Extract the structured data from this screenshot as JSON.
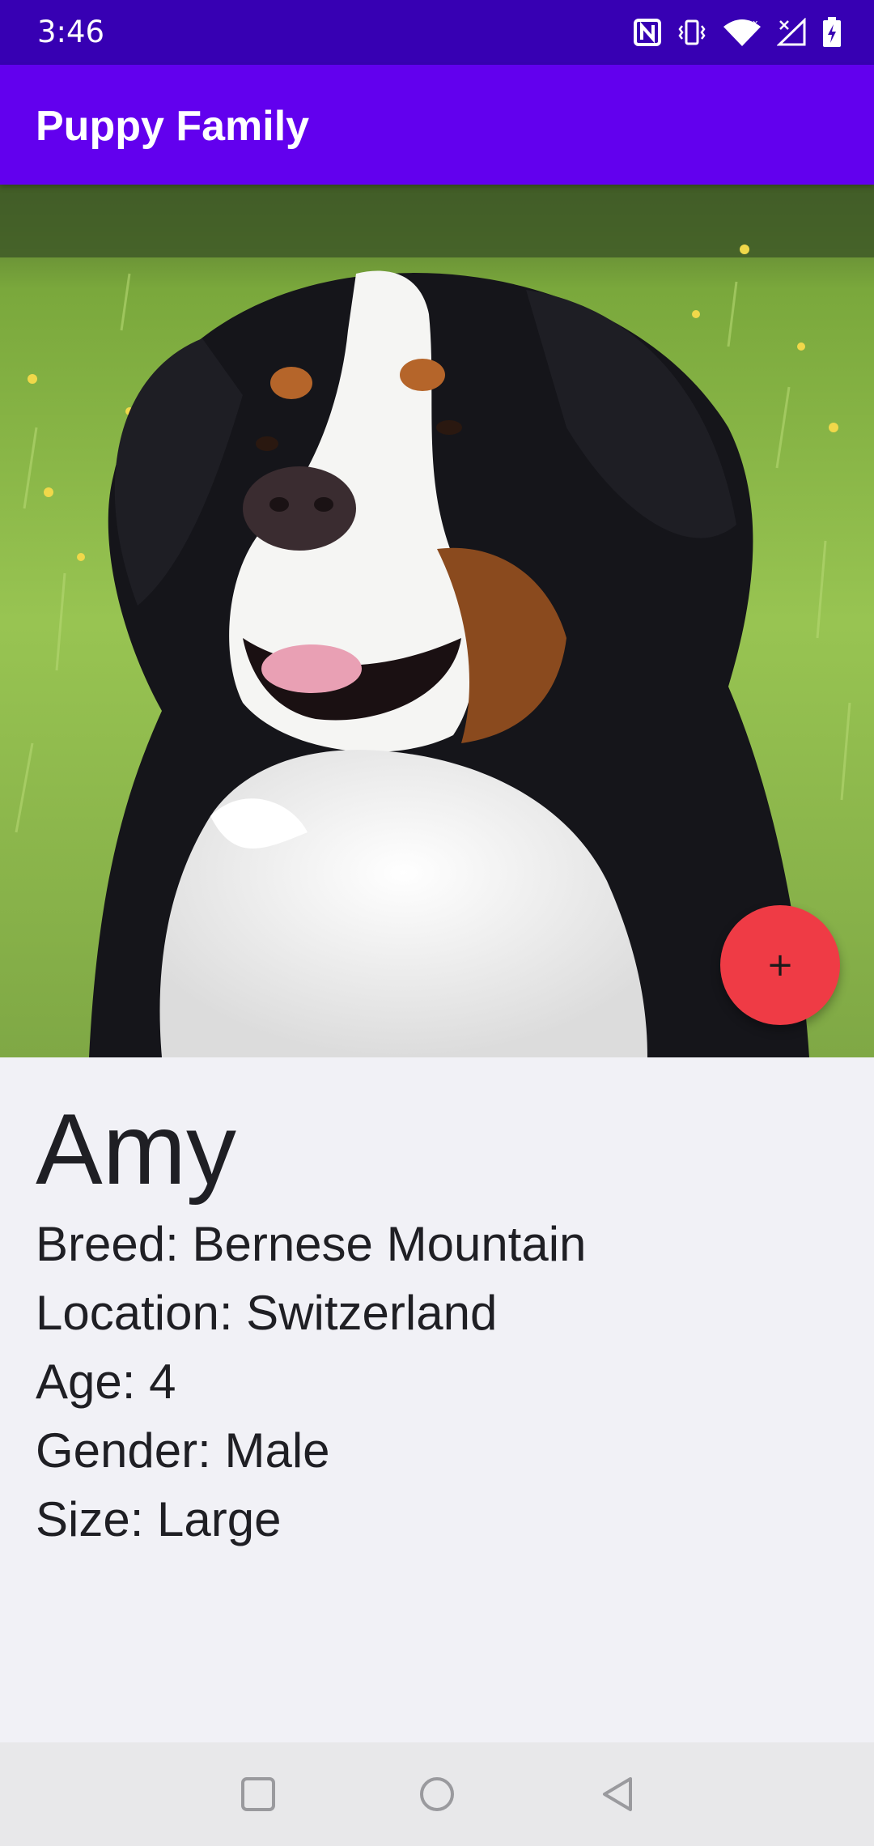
{
  "status_bar": {
    "time": "3:46",
    "icons": [
      "nfc-icon",
      "vibrate-icon",
      "wifi-icon",
      "signal-icon",
      "battery-icon"
    ]
  },
  "app_bar": {
    "title": "Puppy Family",
    "color": "#6200ee"
  },
  "hero": {
    "image": "bernese-mountain-dog-photo"
  },
  "fab": {
    "label": "+",
    "color": "#ef3b45"
  },
  "pet": {
    "name": "Amy",
    "breed": "Breed: Bernese Mountain",
    "location": "Location: Switzerland",
    "age": "Age: 4",
    "gender": "Gender: Male",
    "size": "Size: Large"
  },
  "nav_bar": {
    "buttons": [
      "recents-icon",
      "home-icon",
      "back-icon"
    ]
  }
}
